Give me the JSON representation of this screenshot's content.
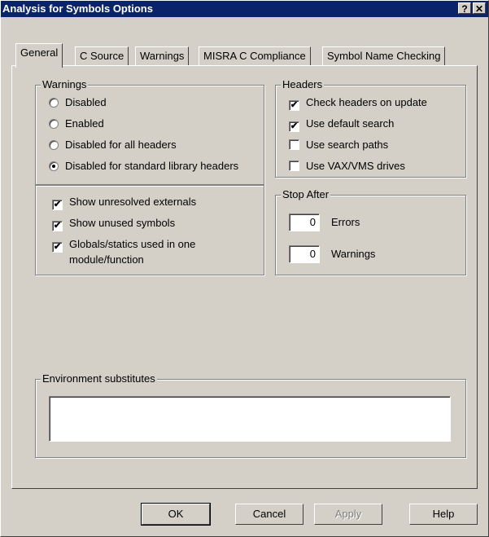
{
  "window": {
    "title": "Analysis for Symbols Options",
    "help_label": "?",
    "close_label": "✕"
  },
  "tabs": [
    {
      "label": "General",
      "active": true
    },
    {
      "label": "C Source",
      "active": false
    },
    {
      "label": "Warnings",
      "active": false
    },
    {
      "label": "MISRA C Compliance",
      "active": false
    },
    {
      "label": "Symbol Name Checking",
      "active": false
    }
  ],
  "warnings_group": {
    "legend": "Warnings",
    "radios": [
      {
        "label": "Disabled",
        "selected": false
      },
      {
        "label": "Enabled",
        "selected": false
      },
      {
        "label": "Disabled for all headers",
        "selected": false
      },
      {
        "label": "Disabled for standard library headers",
        "selected": true
      }
    ],
    "checks": [
      {
        "label": "Show unresolved externals",
        "checked": true
      },
      {
        "label": "Show unused symbols",
        "checked": true
      },
      {
        "label": "Globals/statics used in one",
        "label2": "module/function",
        "checked": true
      }
    ]
  },
  "headers_group": {
    "legend": "Headers",
    "checks": [
      {
        "label": "Check headers on update",
        "checked": true
      },
      {
        "label": "Use default search",
        "checked": true
      },
      {
        "label": "Use search paths",
        "checked": false
      },
      {
        "label": "Use VAX/VMS drives",
        "checked": false
      }
    ]
  },
  "stop_after_group": {
    "legend": "Stop After",
    "errors_value": "0",
    "errors_label": "Errors",
    "warnings_value": "0",
    "warnings_label": "Warnings"
  },
  "environment_group": {
    "legend": "Environment substitutes",
    "value": ""
  },
  "buttons": {
    "ok": "OK",
    "cancel": "Cancel",
    "apply": "Apply",
    "help": "Help"
  },
  "icons": {
    "check": "✔",
    "up_arrow": "▲",
    "down_arrow": "▼"
  }
}
